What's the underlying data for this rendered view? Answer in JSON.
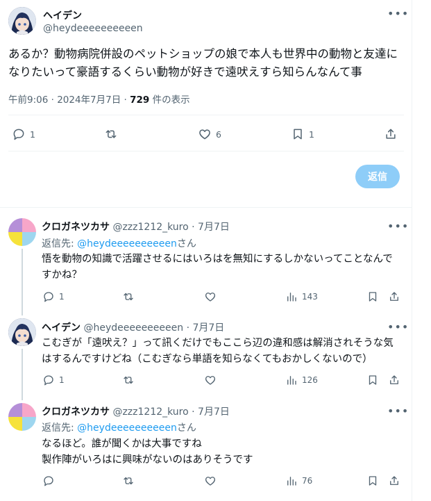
{
  "main_post": {
    "display_name": "ヘイデン",
    "handle": "@heydeeeeeeeeeen",
    "text": "あるか？動物病院併設のペットショップの娘で本人も世界中の動物と友達になりたいって豪語するくらい動物が好きで遠吠えすら知らんなんて事",
    "time_date": "午前9:06 · 2024年7月7日 · ",
    "views_count": "729",
    "views_label": " 件の表示",
    "replies": "1",
    "likes": "6",
    "bookmarks": "1",
    "more_icon": "more-icon",
    "reply_button_label": "返信"
  },
  "replies": [
    {
      "display_name": "クロガネツカサ",
      "handle_time": "@zzz1212_kuro · 7月7日",
      "replying_prefix": "返信先: ",
      "replying_to": "@heydeeeeeeeeeen",
      "replying_suffix": "さん",
      "text": "悟を動物の知識で活躍させるにはいろはを無知にするしかないってことなんですかね？",
      "replies": "1",
      "views": "143"
    },
    {
      "display_name": "ヘイデン",
      "handle_time": "@heydeeeeeeeeeen · 7月7日",
      "text": "こむぎが「遠吠え？」って訊くだけでもここら辺の違和感は解消されそうな気はするんですけどね（こむぎなら単語を知らなくてもおかしくないので）",
      "replies": "1",
      "views": "126"
    },
    {
      "display_name": "クロガネツカサ",
      "handle_time": "@zzz1212_kuro · 7月7日",
      "replying_prefix": "返信先: ",
      "replying_to": "@heydeeeeeeeeeen",
      "replying_suffix": "さん",
      "text_line1": "なるほど。誰が聞くかは大事ですね",
      "text_line2": "製作陣がいろはに興味がないのはありそうです",
      "views": "76"
    }
  ],
  "colors": {
    "accent": "#1d9bf0",
    "reply_button": "#8ecdf8",
    "muted": "#536471"
  }
}
